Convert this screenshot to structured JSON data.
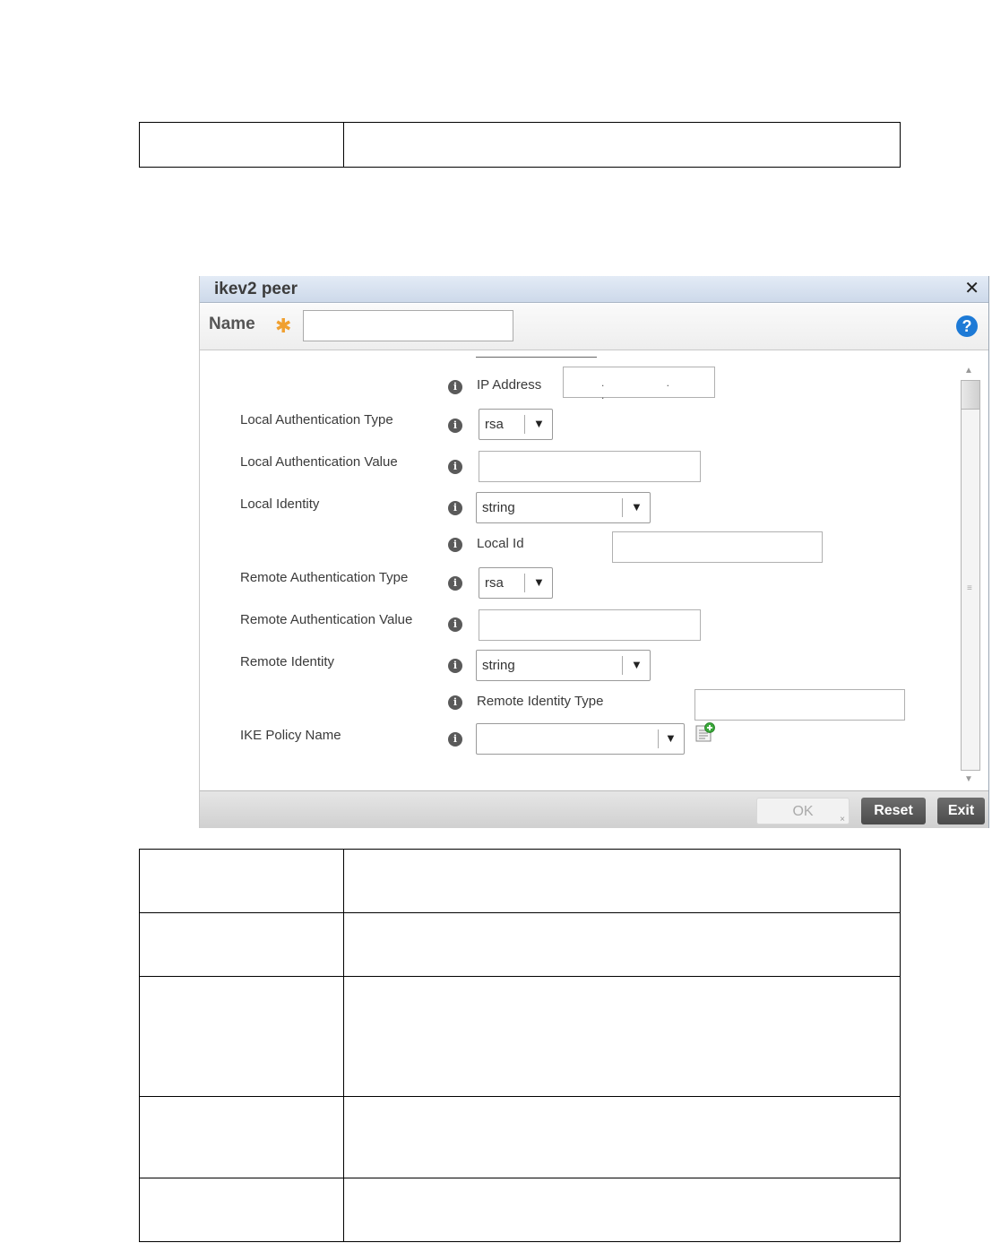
{
  "dialog": {
    "title": "ikev2 peer",
    "close_glyph": "✕",
    "name_label": "Name",
    "required_mark": "✱",
    "name_value": "",
    "help_glyph": "?"
  },
  "form": {
    "ip_address_label": "IP Address",
    "ip_address_value": ". . .",
    "local_auth_type_label": "Local Authentication Type",
    "local_auth_type_value": "rsa",
    "local_auth_value_label": "Local Authentication Value",
    "local_auth_value": "",
    "local_identity_label": "Local Identity",
    "local_identity_value": "string",
    "local_id_label": "Local Id",
    "local_id_value": "",
    "remote_auth_type_label": "Remote Authentication Type",
    "remote_auth_type_value": "rsa",
    "remote_auth_value_label": "Remote Authentication Value",
    "remote_auth_value": "",
    "remote_identity_label": "Remote Identity",
    "remote_identity_value": "string",
    "remote_identity_type_label": "Remote Identity Type",
    "remote_identity_type_value": "",
    "ike_policy_label": "IKE Policy Name",
    "ike_policy_value": "",
    "info_glyph": "i",
    "dropdown_glyph": "▼"
  },
  "footer": {
    "ok_label": "OK",
    "reset_label": "Reset",
    "exit_label": "Exit"
  },
  "icons": {
    "info": "info-icon",
    "help": "help-icon",
    "close": "close-icon",
    "add_policy": "add-document-icon"
  },
  "colors": {
    "required_star": "#f0a030",
    "help_blue": "#1d7ad6",
    "title_bar": "#cdd9ea"
  }
}
